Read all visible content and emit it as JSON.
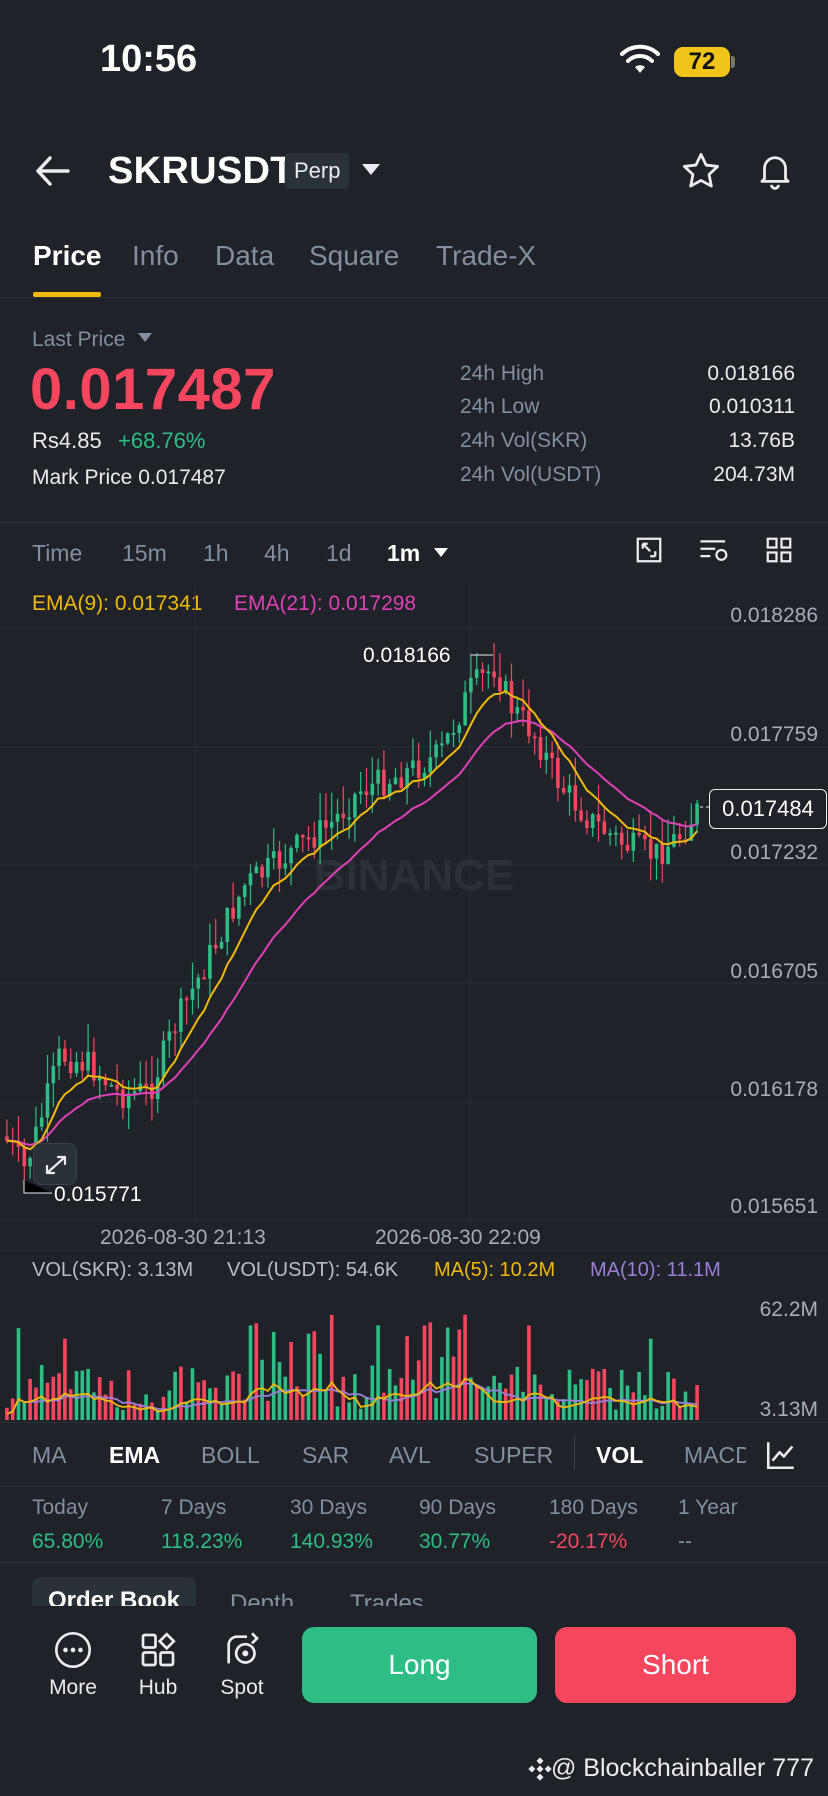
{
  "status_bar": {
    "time": "10:56",
    "battery": "72"
  },
  "header": {
    "symbol": "SKRUSDT",
    "badge": "Perp",
    "icons": [
      "back-arrow-icon",
      "chevron-down-icon",
      "star-icon",
      "bell-icon"
    ]
  },
  "tabs": [
    "Price",
    "Info",
    "Data",
    "Square",
    "Trade-X"
  ],
  "price": {
    "last_price_label": "Last Price",
    "value": "0.017487",
    "fiat": "Rs4.85",
    "change": "+68.76%",
    "mark_price_label": "Mark Price",
    "mark_price": "0.017487"
  },
  "stats": [
    {
      "label": "24h High",
      "value": "0.018166"
    },
    {
      "label": "24h Low",
      "value": "0.010311"
    },
    {
      "label": "24h Vol(SKR)",
      "value": "13.76B"
    },
    {
      "label": "24h Vol(USDT)",
      "value": "204.73M"
    }
  ],
  "intervals": [
    "Time",
    "15m",
    "1h",
    "4h",
    "1d",
    "1m"
  ],
  "chart": {
    "ema9": "EMA(9): 0.017341",
    "ema21": "EMA(21): 0.017298",
    "y_ticks": [
      "0.018286",
      "0.017759",
      "0.017232",
      "0.016705",
      "0.016178",
      "0.015651"
    ],
    "current_price": "0.017484",
    "high_label": "0.018166",
    "low_label": "0.015771",
    "x_ticks": [
      "2026-08-30 21:13",
      "2026-08-30 22:09"
    ],
    "watermark": "BINANCE"
  },
  "volume": {
    "vol_skr": "VOL(SKR): 3.13M",
    "vol_usdt": "VOL(USDT): 54.6K",
    "ma5": "MA(5): 10.2M",
    "ma10": "MA(10): 11.1M",
    "top": "62.2M",
    "bottom": "3.13M"
  },
  "indicators": [
    "MA",
    "EMA",
    "BOLL",
    "SAR",
    "AVL",
    "SUPER",
    "VOL",
    "MACD"
  ],
  "performance": [
    {
      "label": "Today",
      "value": "65.80%",
      "sign": "pos"
    },
    {
      "label": "7 Days",
      "value": "118.23%",
      "sign": "pos"
    },
    {
      "label": "30 Days",
      "value": "140.93%",
      "sign": "pos"
    },
    {
      "label": "90 Days",
      "value": "30.77%",
      "sign": "pos"
    },
    {
      "label": "180 Days",
      "value": "-20.17%",
      "sign": "neg"
    },
    {
      "label": "1 Year",
      "value": "--",
      "sign": "none"
    }
  ],
  "orderbook_tabs": [
    "Order Book",
    "Depth",
    "Trades"
  ],
  "bottom": {
    "more": "More",
    "hub": "Hub",
    "spot": "Spot",
    "long": "Long",
    "short": "Short"
  },
  "credit": "@ Blockchainballer 777",
  "colors": {
    "up": "#2ebd85",
    "down": "#f6465d",
    "ema9": "#f0b90b",
    "ema21": "#e040b8",
    "ma10": "#9b7fd8",
    "accent": "#f0b90b"
  }
}
